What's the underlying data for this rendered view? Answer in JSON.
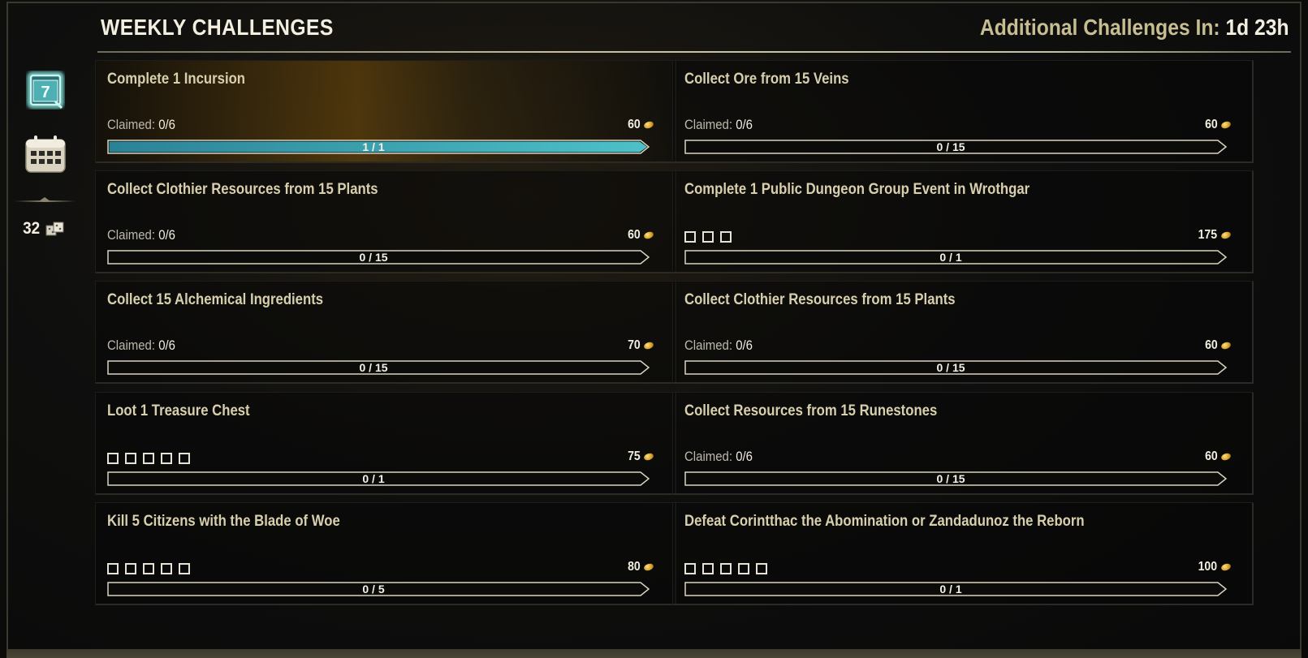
{
  "header": {
    "title": "WEEKLY CHALLENGES",
    "timer_label": "Additional Challenges In: ",
    "timer_value": "1d 23h"
  },
  "sidebar": {
    "weekly_icon": "calendar-7-icon",
    "calendar_icon": "calendar-icon",
    "token_count": "32",
    "token_icon": "seals-icon"
  },
  "colors": {
    "accent_bar": "#3aa8b8",
    "title_text": "#d8d0ad",
    "header_text": "#c6bd91",
    "gold": "#d19a1d"
  },
  "challenges": [
    {
      "title": "Complete 1 Incursion",
      "claimed_label": "Claimed: ",
      "claimed_value": "0/6",
      "reward": "60",
      "progress_text": "1 / 1",
      "progress": 1,
      "highlight": true
    },
    {
      "title": "Collect Ore from 15 Veins",
      "claimed_label": "Claimed: ",
      "claimed_value": "0/6",
      "reward": "60",
      "progress_text": "0 / 15",
      "progress": 0
    },
    {
      "title": "Collect Clothier Resources from 15 Plants",
      "claimed_label": "Claimed: ",
      "claimed_value": "0/6",
      "reward": "60",
      "progress_text": "0 / 15",
      "progress": 0
    },
    {
      "title": "Complete 1 Public Dungeon Group Event in Wrothgar",
      "slots": 3,
      "reward": "175",
      "progress_text": "0 / 1",
      "progress": 0
    },
    {
      "title": "Collect 15 Alchemical Ingredients",
      "claimed_label": "Claimed: ",
      "claimed_value": "0/6",
      "reward": "70",
      "progress_text": "0 / 15",
      "progress": 0
    },
    {
      "title": "Collect Clothier Resources from 15 Plants",
      "claimed_label": "Claimed: ",
      "claimed_value": "0/6",
      "reward": "60",
      "progress_text": "0 / 15",
      "progress": 0
    },
    {
      "title": "Loot 1 Treasure Chest",
      "slots": 5,
      "reward": "75",
      "progress_text": "0 / 1",
      "progress": 0
    },
    {
      "title": "Collect Resources from 15 Runestones",
      "claimed_label": "Claimed: ",
      "claimed_value": "0/6",
      "reward": "60",
      "progress_text": "0 / 15",
      "progress": 0
    },
    {
      "title": "Kill 5 Citizens with the Blade of Woe",
      "slots": 5,
      "reward": "80",
      "progress_text": "0 / 5",
      "progress": 0
    },
    {
      "title": "Defeat Corintthac the Abomination or Zandadunoz the Reborn",
      "slots": 5,
      "reward": "100",
      "progress_text": "0 / 1",
      "progress": 0
    }
  ]
}
